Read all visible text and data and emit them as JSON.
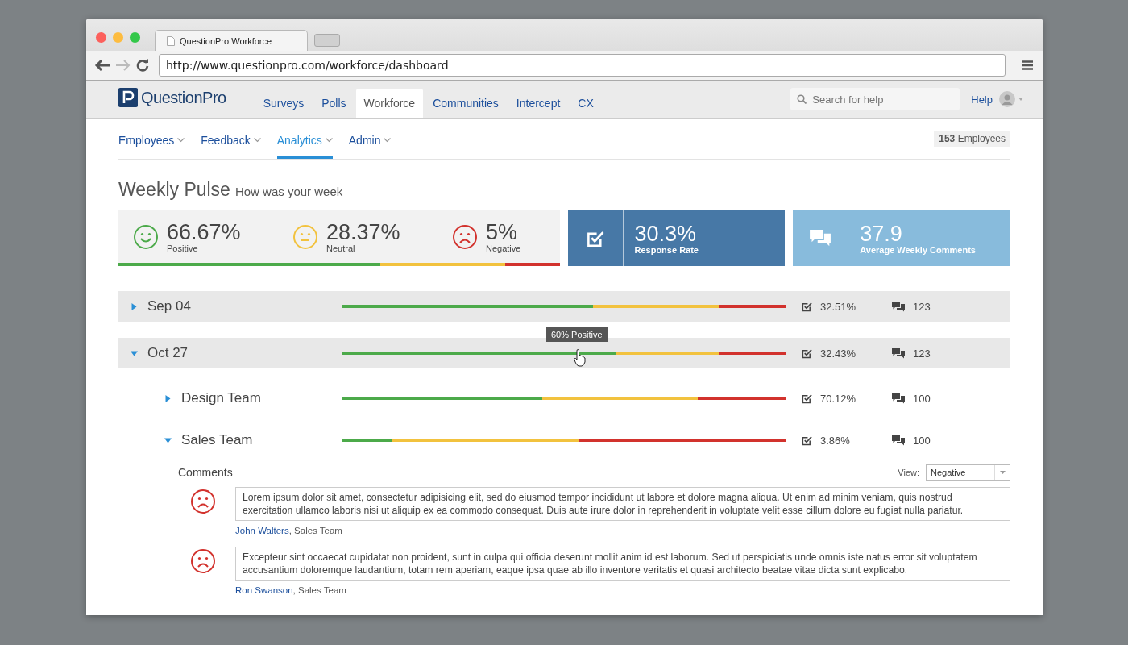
{
  "browser": {
    "tab_title": "QuestionPro Workforce",
    "url": "http://www.questionpro.com/workforce/dashboard"
  },
  "app_nav": {
    "logo": "QuestionPro",
    "tabs": [
      {
        "label": "Surveys",
        "selected": false
      },
      {
        "label": "Polls",
        "selected": false
      },
      {
        "label": "Workforce",
        "selected": true
      },
      {
        "label": "Communities",
        "selected": false
      },
      {
        "label": "Intercept",
        "selected": false
      },
      {
        "label": "CX",
        "selected": false
      }
    ],
    "search": {
      "placeholder": "Search for help"
    },
    "help": "Help"
  },
  "sub_nav": {
    "items": [
      {
        "label": "Employees",
        "selected": false
      },
      {
        "label": "Feedback",
        "selected": false
      },
      {
        "label": "Analytics",
        "selected": true
      },
      {
        "label": "Admin",
        "selected": false
      }
    ],
    "badge": "**153** Employees"
  },
  "page": {
    "title": "Weekly Pulse",
    "subtitle": "How was your week"
  },
  "summary": {
    "stats": [
      {
        "kind": "positive",
        "value": "66.67%",
        "label": "Positive"
      },
      {
        "kind": "neutral",
        "value": "28.37%",
        "label": "Neutral"
      },
      {
        "kind": "negative",
        "value": "5%",
        "label": "Negative"
      }
    ],
    "bar": {
      "positive": {
        "level": 0.593
      },
      "positive_and_neutral": {
        "level": 0.876
      }
    },
    "tiles": [
      {
        "kind": "response",
        "value": "30.3%",
        "label": "Response Rate"
      },
      {
        "kind": "comments",
        "value": "37.9",
        "label": "Average Weekly Comments"
      }
    ]
  },
  "weeks": [
    {
      "label": "Sep 04",
      "expanded": false,
      "bar": {
        "positive": {
          "level": 0.565
        },
        "positive_and_neutral": {
          "level": 0.849
        }
      },
      "response_rate": "32.51%",
      "comment_count": "123"
    },
    {
      "label": "Oct 27",
      "expanded": true,
      "tooltip": "60% Positive",
      "bar": {
        "positive": {
          "level": 0.616
        },
        "positive_and_neutral": {
          "level": 0.849
        }
      },
      "response_rate": "32.43%",
      "comment_count": "123",
      "children": [
        {
          "label": "Design Team",
          "expanded": false,
          "bar": {
            "positive": {
              "level": 0.451
            },
            "positive_and_neutral": {
              "level": 0.802
            }
          },
          "response_rate": "70.12%",
          "comment_count": "100"
        },
        {
          "label": "Sales Team",
          "expanded": true,
          "bar": {
            "positive": {
              "level": 0.111
            },
            "positive_and_neutral": {
              "level": 0.533
            }
          },
          "response_rate": "3.86%",
          "comment_count": "100",
          "comments": {
            "title": "Comments",
            "view_label": "View:",
            "view_value": "Negative",
            "items": [
              {
                "kind": "negative",
                "text": "Lorem ipsum dolor sit amet, consectetur adipisicing elit, sed do eiusmod tempor incididunt ut labore et dolore magna aliqua. Ut enim ad minim veniam, quis nostrud exercitation ullamco laboris nisi ut aliquip ex ea commodo consequat. Duis aute irure dolor in reprehenderit in voluptate velit esse cillum dolore eu fugiat nulla pariatur.",
                "author": "John Walters",
                "team": ", Sales Team"
              },
              {
                "kind": "negative",
                "text": "Excepteur sint occaecat cupidatat non proident, sunt in culpa qui officia deserunt mollit anim id est laborum. Sed ut perspiciatis unde omnis iste natus error sit voluptatem accusantium doloremque laudantium, totam rem aperiam, eaque ipsa quae ab illo inventore veritatis et quasi architecto beatae vitae dicta sunt explicabo.",
                "author": "Ron Swanson",
                "team": ", Sales Team"
              }
            ]
          }
        }
      ]
    }
  ]
}
